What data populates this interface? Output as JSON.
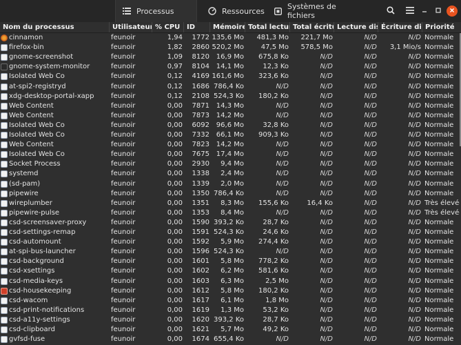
{
  "tabs": [
    {
      "label": "Processus",
      "icon": "list-icon"
    },
    {
      "label": "Ressources",
      "icon": "gauge-icon"
    },
    {
      "label": "Systèmes de fichiers",
      "icon": "disk-icon"
    }
  ],
  "columns": [
    "Nom du processus",
    "Utilisateur",
    "% CPU",
    "ID",
    "Mémoire",
    "Total lecture d",
    "Total écriture d",
    "Lecture disque",
    "Écriture disque",
    "Priorité"
  ],
  "colors": {
    "accent": "#e95420",
    "bg": "#2f2f2f",
    "titlebar": "#262626"
  },
  "rows": [
    {
      "name": "cinnamon",
      "user": "feunoir",
      "cpu": "1,94",
      "id": "1772",
      "mem": "135,6 Mo",
      "tr": "481,3 Mo",
      "tw": "221,7 Mo",
      "rd": "N/D",
      "wd": "N/D",
      "prio": "Normale",
      "icon": "cinnamon-icon"
    },
    {
      "name": "firefox-bin",
      "user": "feunoir",
      "cpu": "1,82",
      "id": "2860",
      "mem": "520,2 Mo",
      "tr": "47,5 Mo",
      "tw": "578,5 Mo",
      "rd": "N/D",
      "wd": "3,1 Mio/s",
      "prio": "Normale",
      "icon": "app-icon"
    },
    {
      "name": "gnome-screenshot",
      "user": "feunoir",
      "cpu": "1,09",
      "id": "8120",
      "mem": "16,9 Mo",
      "tr": "675,8 Ko",
      "tw": "N/D",
      "rd": "N/D",
      "wd": "N/D",
      "prio": "Normale",
      "icon": "app-icon"
    },
    {
      "name": "gnome-system-monitor",
      "user": "feunoir",
      "cpu": "0,97",
      "id": "8104",
      "mem": "14,1 Mo",
      "tr": "12,3 Ko",
      "tw": "N/D",
      "rd": "N/D",
      "wd": "N/D",
      "prio": "Normale",
      "icon": "monitor-icon"
    },
    {
      "name": "Isolated Web Co",
      "user": "feunoir",
      "cpu": "0,12",
      "id": "4169",
      "mem": "161,6 Mo",
      "tr": "323,6 Ko",
      "tw": "N/D",
      "rd": "N/D",
      "wd": "N/D",
      "prio": "Normale",
      "icon": "app-icon"
    },
    {
      "name": "at-spi2-registryd",
      "user": "feunoir",
      "cpu": "0,12",
      "id": "1686",
      "mem": "786,4 Ko",
      "tr": "N/D",
      "tw": "N/D",
      "rd": "N/D",
      "wd": "N/D",
      "prio": "Normale",
      "icon": "app-icon"
    },
    {
      "name": "xdg-desktop-portal-xapp",
      "user": "feunoir",
      "cpu": "0,12",
      "id": "2108",
      "mem": "524,3 Ko",
      "tr": "180,2 Ko",
      "tw": "N/D",
      "rd": "N/D",
      "wd": "N/D",
      "prio": "Normale",
      "icon": "app-icon"
    },
    {
      "name": "Web Content",
      "user": "feunoir",
      "cpu": "0,00",
      "id": "7871",
      "mem": "14,3 Mo",
      "tr": "N/D",
      "tw": "N/D",
      "rd": "N/D",
      "wd": "N/D",
      "prio": "Normale",
      "icon": "app-icon"
    },
    {
      "name": "Web Content",
      "user": "feunoir",
      "cpu": "0,00",
      "id": "7873",
      "mem": "14,2 Mo",
      "tr": "N/D",
      "tw": "N/D",
      "rd": "N/D",
      "wd": "N/D",
      "prio": "Normale",
      "icon": "app-icon"
    },
    {
      "name": "Isolated Web Co",
      "user": "feunoir",
      "cpu": "0,00",
      "id": "6092",
      "mem": "96,6 Mo",
      "tr": "32,8 Ko",
      "tw": "N/D",
      "rd": "N/D",
      "wd": "N/D",
      "prio": "Normale",
      "icon": "app-icon"
    },
    {
      "name": "Isolated Web Co",
      "user": "feunoir",
      "cpu": "0,00",
      "id": "7332",
      "mem": "66,1 Mo",
      "tr": "909,3 Ko",
      "tw": "N/D",
      "rd": "N/D",
      "wd": "N/D",
      "prio": "Normale",
      "icon": "app-icon"
    },
    {
      "name": "Web Content",
      "user": "feunoir",
      "cpu": "0,00",
      "id": "7823",
      "mem": "14,2 Mo",
      "tr": "N/D",
      "tw": "N/D",
      "rd": "N/D",
      "wd": "N/D",
      "prio": "Normale",
      "icon": "app-icon"
    },
    {
      "name": "Isolated Web Co",
      "user": "feunoir",
      "cpu": "0,00",
      "id": "7675",
      "mem": "17,4 Mo",
      "tr": "N/D",
      "tw": "N/D",
      "rd": "N/D",
      "wd": "N/D",
      "prio": "Normale",
      "icon": "app-icon"
    },
    {
      "name": "Socket Process",
      "user": "feunoir",
      "cpu": "0,00",
      "id": "2930",
      "mem": "9,4 Mo",
      "tr": "N/D",
      "tw": "N/D",
      "rd": "N/D",
      "wd": "N/D",
      "prio": "Normale",
      "icon": "app-icon"
    },
    {
      "name": "systemd",
      "user": "feunoir",
      "cpu": "0,00",
      "id": "1338",
      "mem": "2,4 Mo",
      "tr": "N/D",
      "tw": "N/D",
      "rd": "N/D",
      "wd": "N/D",
      "prio": "Normale",
      "icon": "app-icon"
    },
    {
      "name": "(sd-pam)",
      "user": "feunoir",
      "cpu": "0,00",
      "id": "1339",
      "mem": "2,0 Mo",
      "tr": "N/D",
      "tw": "N/D",
      "rd": "N/D",
      "wd": "N/D",
      "prio": "Normale",
      "icon": "app-icon"
    },
    {
      "name": "pipewire",
      "user": "feunoir",
      "cpu": "0,00",
      "id": "1350",
      "mem": "786,4 Ko",
      "tr": "N/D",
      "tw": "N/D",
      "rd": "N/D",
      "wd": "N/D",
      "prio": "Normale",
      "icon": "app-icon"
    },
    {
      "name": "wireplumber",
      "user": "feunoir",
      "cpu": "0,00",
      "id": "1351",
      "mem": "8,3 Mo",
      "tr": "155,6 Ko",
      "tw": "16,4 Ko",
      "rd": "N/D",
      "wd": "N/D",
      "prio": "Très élevée",
      "icon": "app-icon"
    },
    {
      "name": "pipewire-pulse",
      "user": "feunoir",
      "cpu": "0,00",
      "id": "1353",
      "mem": "8,4 Mo",
      "tr": "N/D",
      "tw": "N/D",
      "rd": "N/D",
      "wd": "N/D",
      "prio": "Très élevée",
      "icon": "app-icon"
    },
    {
      "name": "csd-screensaver-proxy",
      "user": "feunoir",
      "cpu": "0,00",
      "id": "1590",
      "mem": "393,2 Ko",
      "tr": "28,7 Ko",
      "tw": "N/D",
      "rd": "N/D",
      "wd": "N/D",
      "prio": "Normale",
      "icon": "app-icon"
    },
    {
      "name": "csd-settings-remap",
      "user": "feunoir",
      "cpu": "0,00",
      "id": "1591",
      "mem": "524,3 Ko",
      "tr": "24,6 Ko",
      "tw": "N/D",
      "rd": "N/D",
      "wd": "N/D",
      "prio": "Normale",
      "icon": "app-icon"
    },
    {
      "name": "csd-automount",
      "user": "feunoir",
      "cpu": "0,00",
      "id": "1592",
      "mem": "5,9 Mo",
      "tr": "274,4 Ko",
      "tw": "N/D",
      "rd": "N/D",
      "wd": "N/D",
      "prio": "Normale",
      "icon": "app-icon"
    },
    {
      "name": "at-spi-bus-launcher",
      "user": "feunoir",
      "cpu": "0,00",
      "id": "1596",
      "mem": "524,3 Ko",
      "tr": "N/D",
      "tw": "N/D",
      "rd": "N/D",
      "wd": "N/D",
      "prio": "Normale",
      "icon": "app-icon"
    },
    {
      "name": "csd-background",
      "user": "feunoir",
      "cpu": "0,00",
      "id": "1601",
      "mem": "5,8 Mo",
      "tr": "778,2 Ko",
      "tw": "N/D",
      "rd": "N/D",
      "wd": "N/D",
      "prio": "Normale",
      "icon": "app-icon"
    },
    {
      "name": "csd-xsettings",
      "user": "feunoir",
      "cpu": "0,00",
      "id": "1602",
      "mem": "6,2 Mo",
      "tr": "581,6 Ko",
      "tw": "N/D",
      "rd": "N/D",
      "wd": "N/D",
      "prio": "Normale",
      "icon": "app-icon"
    },
    {
      "name": "csd-media-keys",
      "user": "feunoir",
      "cpu": "0,00",
      "id": "1603",
      "mem": "6,3 Mo",
      "tr": "2,5 Mo",
      "tw": "N/D",
      "rd": "N/D",
      "wd": "N/D",
      "prio": "Normale",
      "icon": "app-icon"
    },
    {
      "name": "csd-housekeeping",
      "user": "feunoir",
      "cpu": "0,00",
      "id": "1612",
      "mem": "5,8 Mo",
      "tr": "180,2 Ko",
      "tw": "N/D",
      "rd": "N/D",
      "wd": "N/D",
      "prio": "Normale",
      "icon": "housekeeping-icon"
    },
    {
      "name": "csd-wacom",
      "user": "feunoir",
      "cpu": "0,00",
      "id": "1617",
      "mem": "6,1 Mo",
      "tr": "1,8 Mo",
      "tw": "N/D",
      "rd": "N/D",
      "wd": "N/D",
      "prio": "Normale",
      "icon": "app-icon"
    },
    {
      "name": "csd-print-notifications",
      "user": "feunoir",
      "cpu": "0,00",
      "id": "1619",
      "mem": "1,3 Mo",
      "tr": "53,2 Ko",
      "tw": "N/D",
      "rd": "N/D",
      "wd": "N/D",
      "prio": "Normale",
      "icon": "app-icon"
    },
    {
      "name": "csd-a11y-settings",
      "user": "feunoir",
      "cpu": "0,00",
      "id": "1620",
      "mem": "393,2 Ko",
      "tr": "28,7 Ko",
      "tw": "N/D",
      "rd": "N/D",
      "wd": "N/D",
      "prio": "Normale",
      "icon": "app-icon"
    },
    {
      "name": "csd-clipboard",
      "user": "feunoir",
      "cpu": "0,00",
      "id": "1621",
      "mem": "5,7 Mo",
      "tr": "49,2 Ko",
      "tw": "N/D",
      "rd": "N/D",
      "wd": "N/D",
      "prio": "Normale",
      "icon": "app-icon"
    },
    {
      "name": "gvfsd-fuse",
      "user": "feunoir",
      "cpu": "0,00",
      "id": "1674",
      "mem": "655,4 Ko",
      "tr": "N/D",
      "tw": "N/D",
      "rd": "N/D",
      "wd": "N/D",
      "prio": "Normale",
      "icon": "app-icon"
    }
  ]
}
